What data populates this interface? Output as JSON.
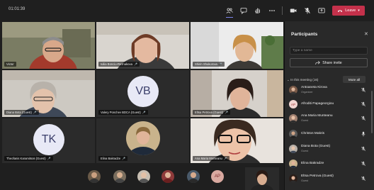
{
  "meeting": {
    "timer": "01:01:39",
    "leave_label": "Leave",
    "accent_color": "#c4314b",
    "brand_color": "#7b83eb"
  },
  "toolbar_icons": [
    "people-icon",
    "chat-icon",
    "raise-hand-icon",
    "more-icon",
    "camera-icon",
    "mic-off-icon",
    "share-screen-icon",
    "phone-icon"
  ],
  "tiles": [
    {
      "name": "Victor",
      "mic": ""
    },
    {
      "name": "Iuliia Bonciu-Reznakova",
      "mic": "🎤"
    },
    {
      "name": "Shirin Shukurova",
      "mic": "🎤"
    },
    {
      "name": "Diana Bota (Guest)",
      "mic": "🎤"
    },
    {
      "name": "Valery Ponchev BDCA (Guest)",
      "mic": "🎤",
      "initials": "VB"
    },
    {
      "name": "Eltsa Petrova (Guest)",
      "mic": "🎤"
    },
    {
      "name": "Theofanis Karamitsos (Guest)",
      "mic": "🎤",
      "initials": "TK"
    },
    {
      "name": "Elina Bakradze",
      "mic": "🎤"
    },
    {
      "name": "Ana Maria Munteanu",
      "mic": "🎤"
    }
  ],
  "strip": {
    "initials_chip": "AP"
  },
  "panel": {
    "title": "Participants",
    "search_placeholder": "Type a name",
    "share_invite_label": "Share invite",
    "section_label": "In this meeting (16)",
    "mute_all_label": "Mute all",
    "participants": [
      {
        "name": "Antoaneta Kirova",
        "role": "Organizer",
        "initials": ""
      },
      {
        "name": "Afroditi Papageorgiou",
        "role": "",
        "initials": "AP"
      },
      {
        "name": "Ana Maria Munteanu",
        "role": "Guest",
        "initials": ""
      },
      {
        "name": "Christos Makris",
        "role": "",
        "initials": ""
      },
      {
        "name": "Diana Bota (Guest)",
        "role": "Guest",
        "initials": ""
      },
      {
        "name": "Elina Bakradze",
        "role": "",
        "initials": ""
      },
      {
        "name": "Eltsa Petrova (Guest)",
        "role": "Guest",
        "initials": ""
      }
    ]
  }
}
